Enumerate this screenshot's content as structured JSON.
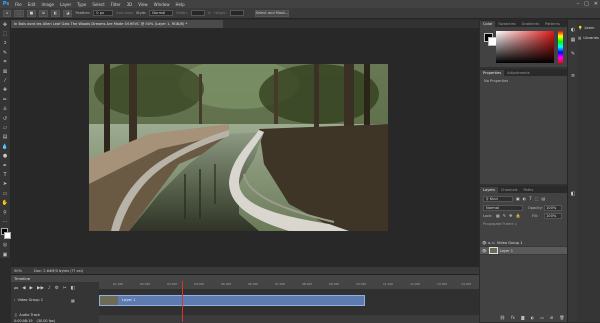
{
  "menubar": {
    "items": [
      "File",
      "Edit",
      "Image",
      "Layer",
      "Type",
      "Select",
      "Filter",
      "3D",
      "View",
      "Window",
      "Help"
    ],
    "window_controls": [
      "–",
      "□",
      "✕"
    ]
  },
  "options": {
    "feather_label": "Feather:",
    "feather_value": "0 px",
    "antialias_label": "Anti-alias",
    "style_label": "Style:",
    "style_value": "Normal",
    "width_label": "Width:",
    "height_label": "Height:",
    "select_mask_label": "Select and Mask..."
  },
  "document": {
    "tab_title": "In Bois dont les Alien Leaf Gals The Woods Dreams Are Made Of.HEVC @ 50% (Layer 1, RGB/8) *",
    "zoom": "50%",
    "doc_info": "Doc: 2.64M/0 bytes (?? cal)"
  },
  "timeline": {
    "title": "Timeline",
    "group_label": "Video Group 1",
    "audio_label": "Audio Track",
    "time_readout": "0:00:08:19",
    "fps": "(30.00 fps)",
    "clip_label": "Layer 1",
    "ruler_ticks": [
      "01:00f",
      "02:00f",
      "03:00f",
      "04:00f",
      "05:00f",
      "06:00f",
      "07:00f",
      "08:00f",
      "09:00f",
      "10:00f",
      "11:00f",
      "12:00f",
      "13:00f",
      "14:00f"
    ]
  },
  "color_panel": {
    "tabs": [
      "Color",
      "Swatches",
      "Gradients",
      "Patterns"
    ]
  },
  "properties_panel": {
    "tabs": [
      "Properties",
      "Adjustments"
    ],
    "body_text": "No Properties"
  },
  "layers_panel": {
    "tabs": [
      "Layers",
      "Channels",
      "Paths"
    ],
    "kind_label": "Kind",
    "blend_mode": "Normal",
    "opacity_label": "Opacity:",
    "opacity_value": "100%",
    "lock_label": "Lock:",
    "fill_label": "Fill:",
    "fill_value": "100%",
    "unify_label": "Propagate Frame 1",
    "layers": [
      {
        "name": "Video Group 1"
      },
      {
        "name": "Layer 1"
      }
    ]
  },
  "far_panel": {
    "items": [
      "Learn",
      "Libraries"
    ]
  },
  "colors": {
    "accent": "#31a8ff",
    "clip": "#5d7bb0",
    "playhead": "#e03030"
  }
}
